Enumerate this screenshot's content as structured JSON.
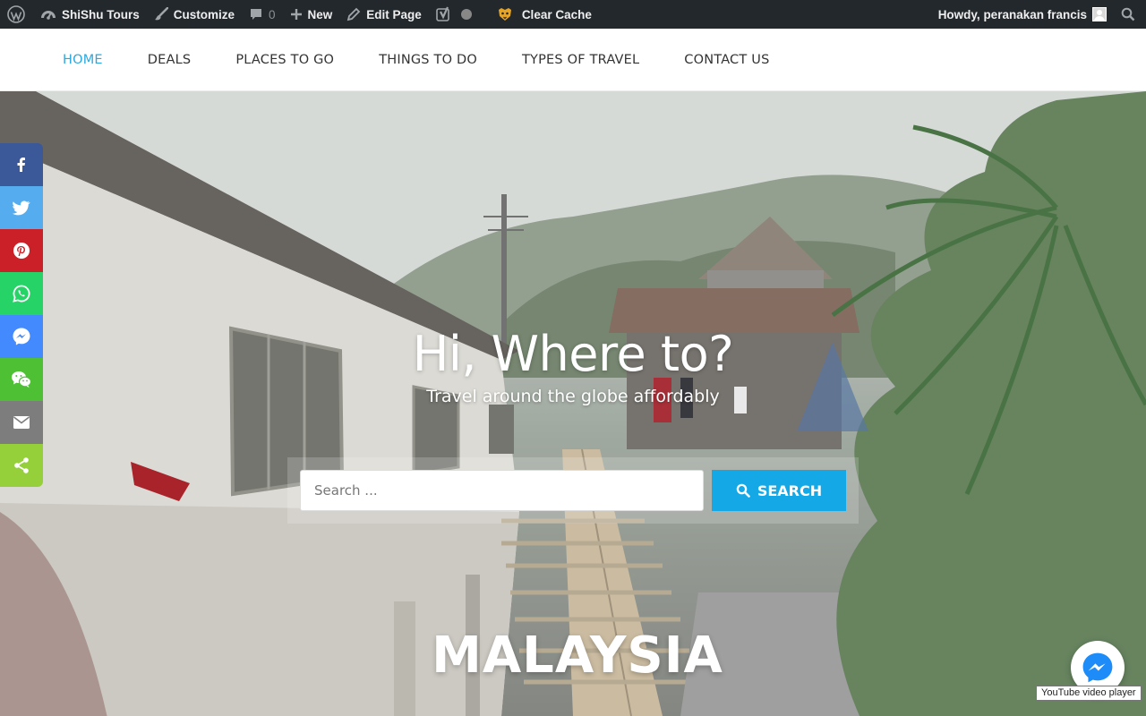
{
  "adminbar": {
    "site_name": "ShiShu Tours",
    "customize": "Customize",
    "comments_count": "0",
    "new": "New",
    "edit_page": "Edit Page",
    "clear_cache": "Clear Cache",
    "howdy": "Howdy, peranakan francis"
  },
  "nav": {
    "items": [
      {
        "label": "HOME",
        "active": true
      },
      {
        "label": "DEALS"
      },
      {
        "label": "PLACES TO GO"
      },
      {
        "label": "THINGS TO DO"
      },
      {
        "label": "TYPES OF TRAVEL"
      },
      {
        "label": "CONTACT US"
      }
    ]
  },
  "hero": {
    "title": "Hi, Where to?",
    "subtitle": "Travel around the globe affordably",
    "search_placeholder": "Search ...",
    "search_button": "SEARCH",
    "video_watermark": "MALAYSIA"
  },
  "share": {
    "buttons": [
      {
        "icon": "facebook-icon",
        "color": "#3b5998"
      },
      {
        "icon": "twitter-icon",
        "color": "#55acee"
      },
      {
        "icon": "pinterest-icon",
        "color": "#cb2027"
      },
      {
        "icon": "whatsapp-icon",
        "color": "#25d366"
      },
      {
        "icon": "messenger-icon",
        "color": "#448aff"
      },
      {
        "icon": "wechat-icon",
        "color": "#4ec034"
      },
      {
        "icon": "email-icon",
        "color": "#7d7d7d"
      },
      {
        "icon": "share-icon",
        "color": "#95d03a"
      }
    ]
  },
  "tooltip": {
    "youtube": "YouTube video player"
  },
  "colors": {
    "accent": "#2aa9df",
    "search_button": "#14a8e6",
    "adminbar": "#23282d"
  }
}
